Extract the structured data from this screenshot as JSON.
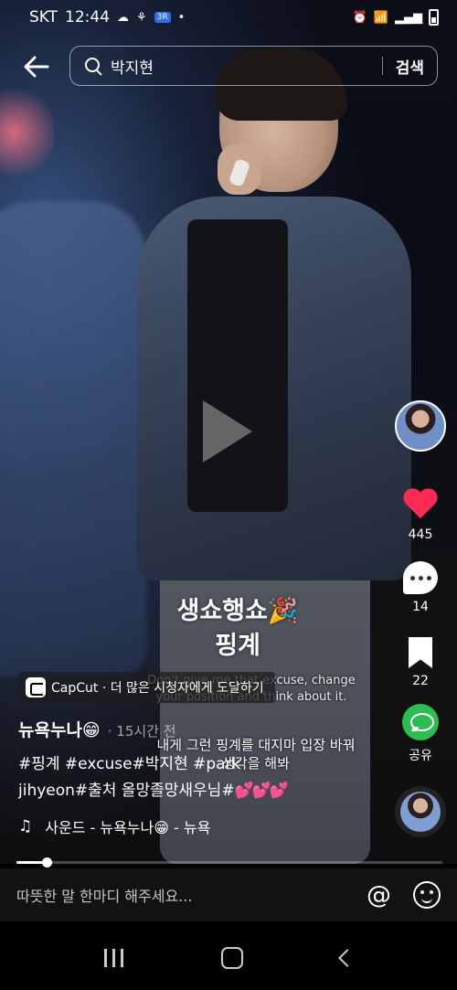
{
  "status_bar": {
    "carrier": "SKT",
    "time": "12:44",
    "badge": "3R"
  },
  "search": {
    "query": "박지현",
    "submit_label": "검색"
  },
  "video": {
    "caption_title_line1": "생쇼행쇼🎉",
    "caption_title_line2": "핑계",
    "subtitle_en": "Don't give me that excuse, change your position and think about it.",
    "subtitle_ko": "내게 그런 핑계를 대지마 입장 바꿔 생각을 해봐",
    "progress_fraction": 0.07
  },
  "rail": {
    "like_count": "445",
    "comment_count": "14",
    "bookmark_count": "22",
    "share_label": "공유"
  },
  "capcut": {
    "label": "CapCut · 더 많은 시청자에게 도달하기"
  },
  "post": {
    "author": "뉴욕누나😁",
    "time_ago": "· 15시간 전",
    "desc_line1": "#핑계 #excuse#박지현 #park",
    "desc_line2": "jihyeon#출처 올망졸망새우님#",
    "desc_hearts": "💕💕💕",
    "sound": "사운드 - 뉴욕누나😁 - 뉴욕"
  },
  "comment_bar": {
    "placeholder": "따뜻한 말 한마디 해주세요..."
  }
}
